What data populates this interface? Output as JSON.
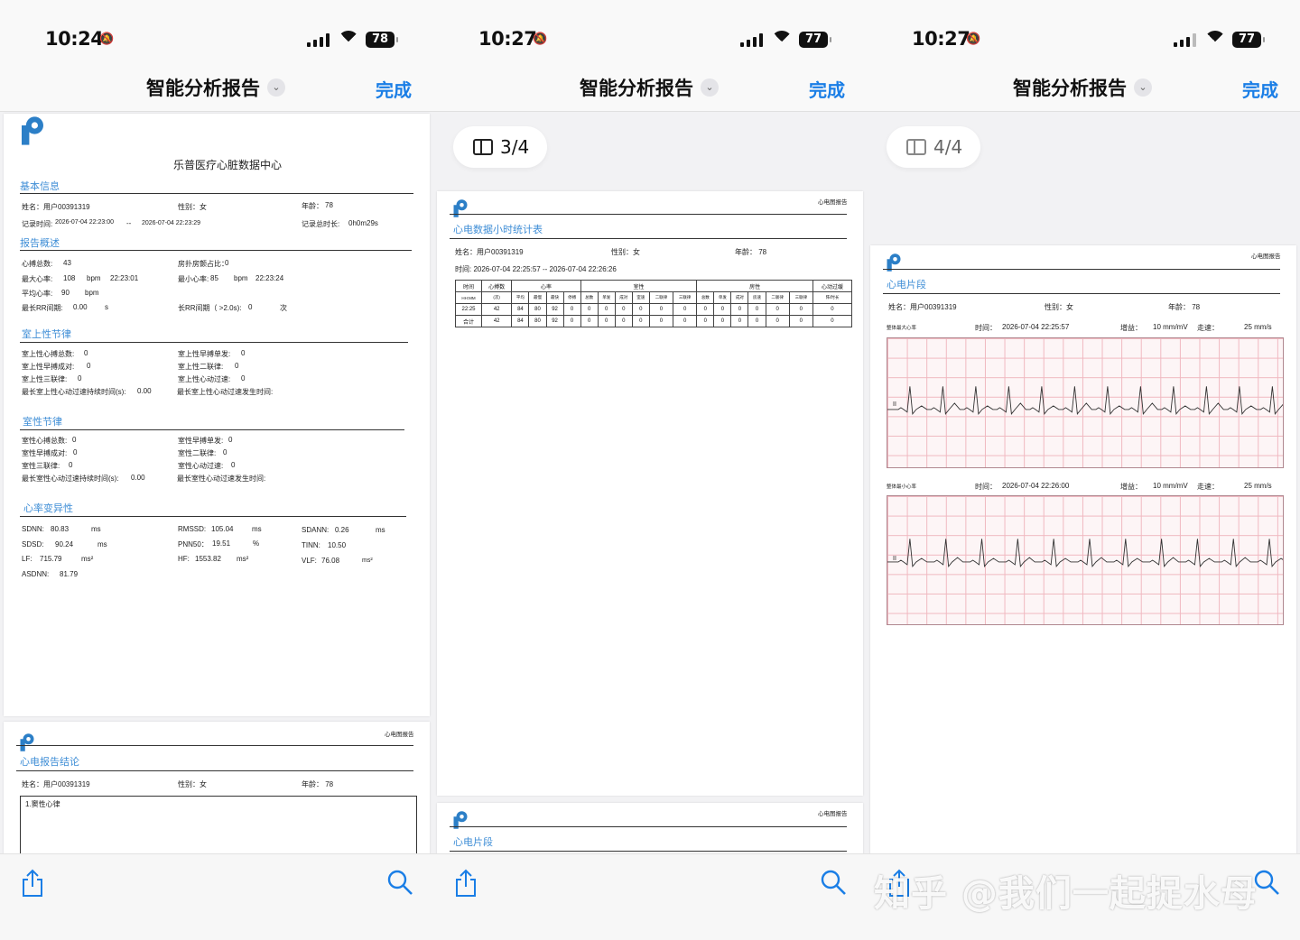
{
  "status": [
    {
      "time": "10:24",
      "battery": "78"
    },
    {
      "time": "10:27",
      "battery": "77"
    },
    {
      "time": "10:27",
      "battery": "77"
    }
  ],
  "nav": {
    "title": "智能分析报告",
    "done": "完成"
  },
  "pill": {
    "p2": "3/4",
    "p3": "4/4"
  },
  "brand": "心电图报告",
  "p1": {
    "center": "乐普医疗心脏数据中心",
    "sec_basic": "基本信息",
    "name": "姓名：用户00391319",
    "gender": "性别：女",
    "age_label": "年龄：",
    "age": "78",
    "rec_label": "记录时间:",
    "rec_start": "2026-07-04 22:23:00",
    "rec_sep": "--",
    "rec_end": "2026-07-04 22:23:29",
    "rec_total_label": "记录总时长:",
    "rec_total": "0h0m29s",
    "sec_summary": "报告概述",
    "s": {
      "beats_l": "心搏总数:",
      "beats": "43",
      "af_l": "房扑房颤占比：",
      "af": "0",
      "maxhr_l": "最大心率:",
      "maxhr": "108",
      "bpm": "bpm",
      "maxhr_t": "22:23:01",
      "minhr_l": "最小心率:",
      "minhr": "85",
      "minhr_t": "22:23:24",
      "avghr_l": "平均心率:",
      "avghr": "90",
      "longrr_l": "最长RR间期:",
      "longrr": "0.00",
      "unit_s": "s",
      "longrr2_l": "长RR间期（ >2.0s):",
      "longrr2": "0",
      "unit_ci": "次"
    },
    "sec_sv": "室上性节律",
    "sv": {
      "a_l": "室上性心搏总数:",
      "a": "0",
      "b_l": "室上性早搏单发:",
      "b": "0",
      "c_l": "室上性早搏成对:",
      "c": "0",
      "d_l": "室上性二联律:",
      "d": "0",
      "e_l": "室上性三联律:",
      "e": "0",
      "f_l": "室上性心动过速:",
      "f": "0",
      "g_l": "最长室上性心动过速持续时间(s):",
      "g": "0.00",
      "h_l": "最长室上性心动过速发生时间:"
    },
    "sec_v": "室性节律",
    "v": {
      "a_l": "室性心搏总数:",
      "a": "0",
      "b_l": "室性早搏单发:",
      "b": "0",
      "c_l": "室性早搏成对:",
      "c": "0",
      "d_l": "室性二联律:",
      "d": "0",
      "e_l": "室性三联律:",
      "e": "0",
      "f_l": "室性心动过速:",
      "f": "0",
      "g_l": "最长室性心动过速持续时间(s):",
      "g": "0.00",
      "h_l": "最长室性心动过速发生时间:"
    },
    "sec_hrv": "心率变异性",
    "hrv": {
      "sdnn_l": "SDNN:",
      "sdnn": "80.83",
      "ms": "ms",
      "rmssd_l": "RMSSD:",
      "rmssd": "105.04",
      "sdann_l": "SDANN:",
      "sdann": "0.26",
      "sdsd_l": "SDSD:",
      "sdsd": "90.24",
      "pnn50_l": "PNN50：",
      "pnn50": "19.51",
      "pct": "%",
      "tinn_l": "TINN:",
      "tinn": "10.50",
      "lf_l": "LF:",
      "lf": "715.79",
      "ms2": "ms²",
      "hf_l": "HF:",
      "hf": "1553.82",
      "vlf_l": "VLF:",
      "vlf": "76.08",
      "asdnn_l": "ASDNN:",
      "asdnn": "81.79"
    },
    "sec_concl": "心电报告结论",
    "concl_name": "姓名：用户00391319",
    "concl_gender": "性别：女",
    "concl_age": "年龄：  78",
    "conclusion": "1.窦性心律"
  },
  "p2": {
    "title": "心电数据小时统计表",
    "name": "姓名：用户00391319",
    "gender": "性别：女",
    "age": "年龄：  78",
    "time": "时间:  2026-07-04 22:25:57      -- 2026-07-04 22:26:26",
    "table": {
      "h1": [
        "时间",
        "心搏数",
        "心率",
        "室性",
        "房性",
        "心动过缓"
      ],
      "h2": [
        "HH:MM",
        "(次)",
        "平均",
        "最慢",
        "最快",
        "停搏",
        "总数",
        "单发",
        "成对",
        "室速",
        "二联律",
        "三联律",
        "总数",
        "单发",
        "成对",
        "房速",
        "二联律",
        "三联律",
        "阵/时长"
      ],
      "rows": [
        [
          "22:25",
          "42",
          "84",
          "80",
          "92",
          "0",
          "0",
          "0",
          "0",
          "0",
          "0",
          "0",
          "0",
          "0",
          "0",
          "0",
          "0",
          "0",
          "0"
        ],
        [
          "合计",
          "42",
          "84",
          "80",
          "92",
          "0",
          "0",
          "0",
          "0",
          "0",
          "0",
          "0",
          "0",
          "0",
          "0",
          "0",
          "0",
          "0",
          "0"
        ]
      ]
    },
    "next_title": "心电片段"
  },
  "p3": {
    "title": "心电片段",
    "name": "姓名：用户00391319",
    "gender": "性别：女",
    "age": "年龄：  78",
    "strips": [
      {
        "label": "整体最大心率",
        "time_l": "时间：",
        "time": "2026-07-04 22:25:57",
        "gain_l": "增益：",
        "gain": "10 mm/mV",
        "speed_l": "走速：",
        "speed": "25 mm/s"
      },
      {
        "label": "整体最小心率",
        "time_l": "时间：",
        "time": "2026-07-04 22:26:00",
        "gain_l": "增益：",
        "gain": "10 mm/mV",
        "speed_l": "走速：",
        "speed": "25 mm/s"
      }
    ],
    "lead": "II"
  },
  "watermark": "知乎 @我们一起捉水母",
  "icons": [
    "bell-slash-icon",
    "cellular-signal-icon",
    "wifi-icon",
    "battery-icon",
    "chevron-down-icon",
    "sidebar-icon",
    "share-icon",
    "search-icon",
    "app-logo"
  ],
  "colors": {
    "accent": "#1a7ee6",
    "section": "#3f8ed6",
    "ecg_grid": "#f0b8c0"
  }
}
